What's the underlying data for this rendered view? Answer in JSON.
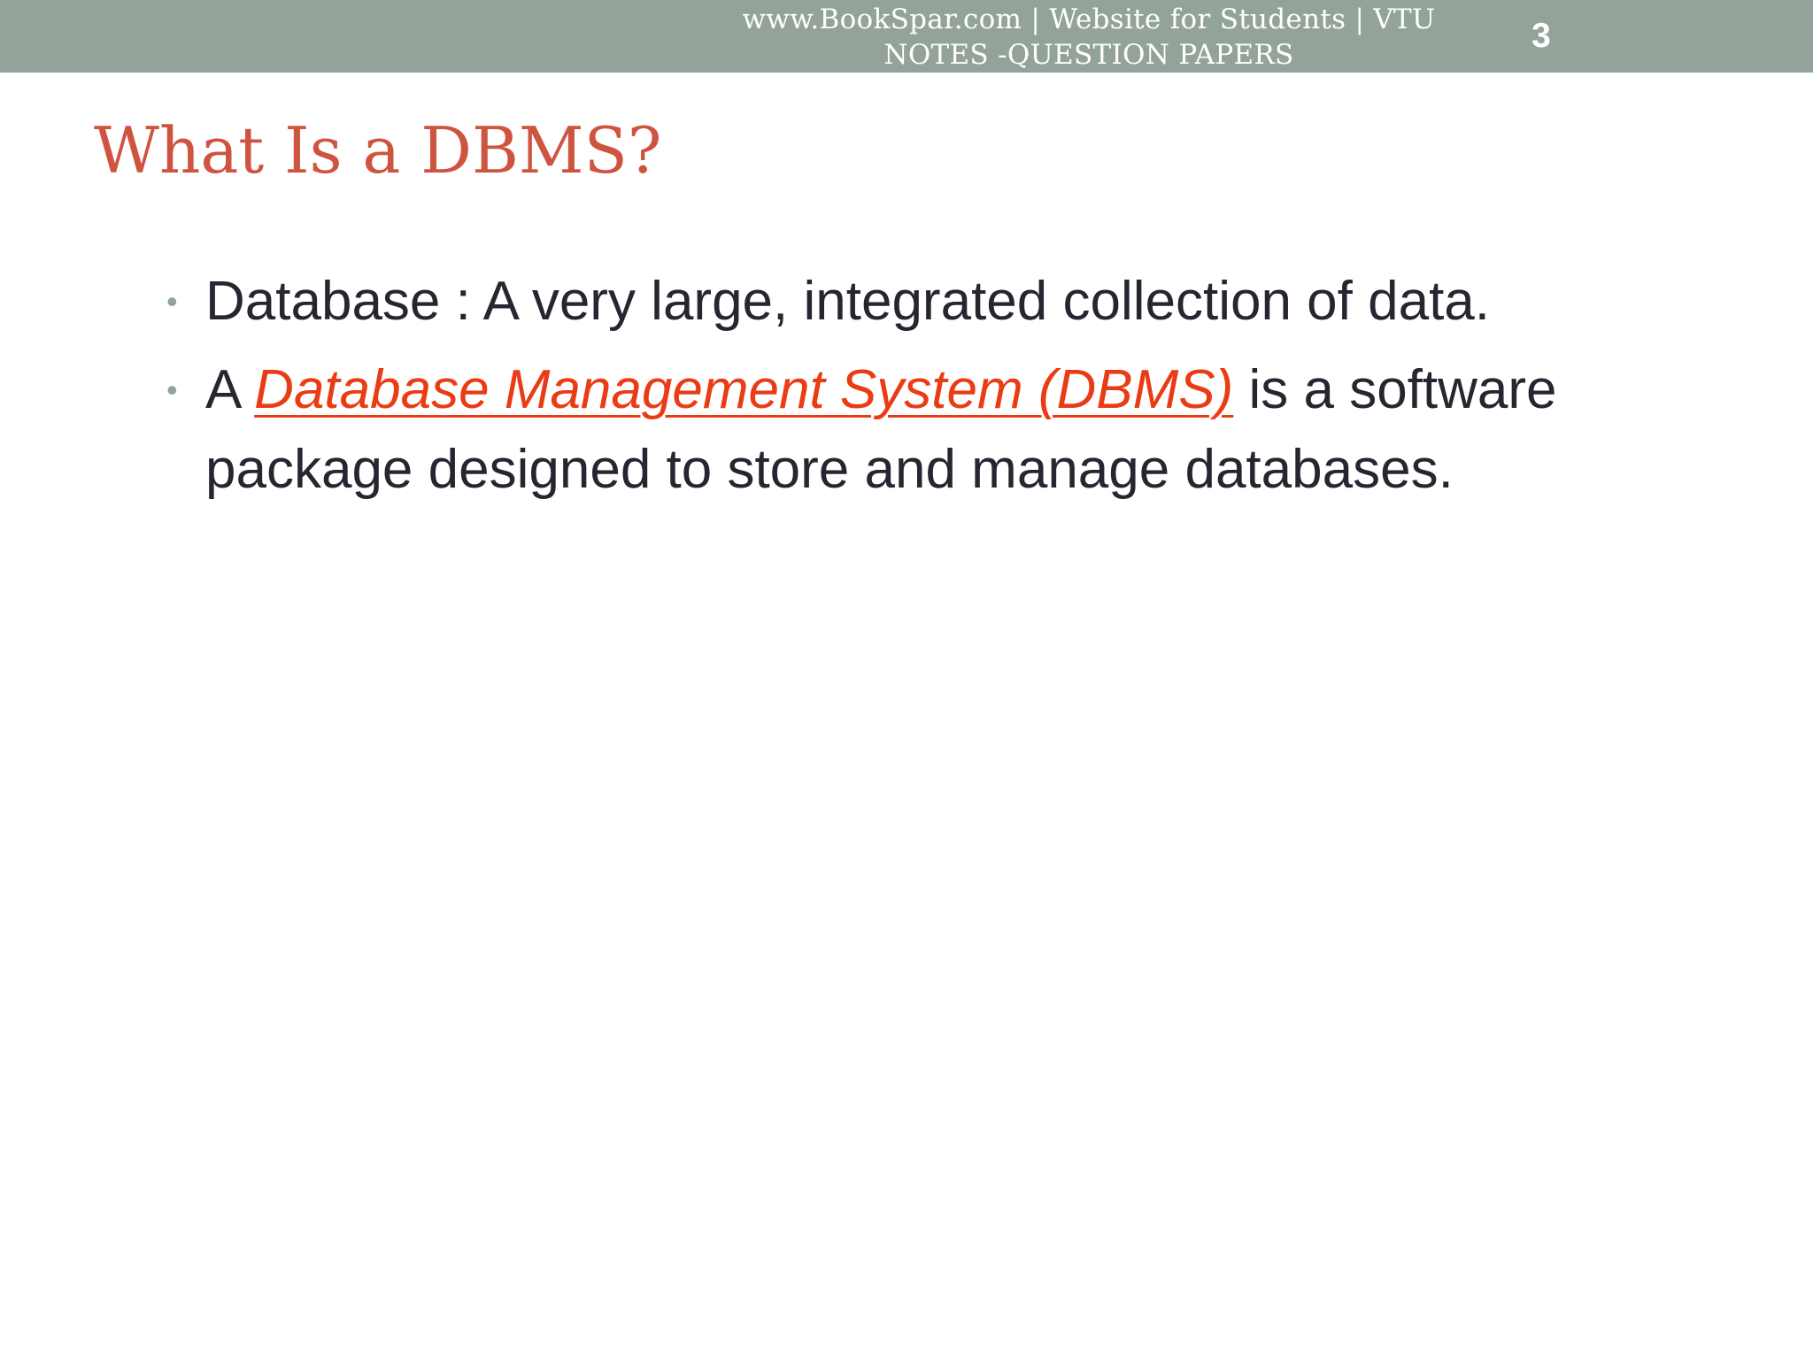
{
  "header": {
    "line1": "www.BookSpar.com  |  Website for Students  |  VTU",
    "line2": "NOTES -QUESTION PAPERS",
    "slide_number": "3"
  },
  "slide": {
    "title": "What Is a DBMS?",
    "bullets": [
      {
        "text": "Database : A very large, integrated collection of data."
      },
      {
        "prefix": "A ",
        "link_text": "Database Management System (DBMS)",
        "suffix": " is a software package designed to store and manage databases."
      }
    ]
  },
  "colors": {
    "header_bar": "#94a39a",
    "title": "#cf5440",
    "link": "#ea3c14",
    "body_text": "#262630",
    "bullet": "#94a39a"
  }
}
